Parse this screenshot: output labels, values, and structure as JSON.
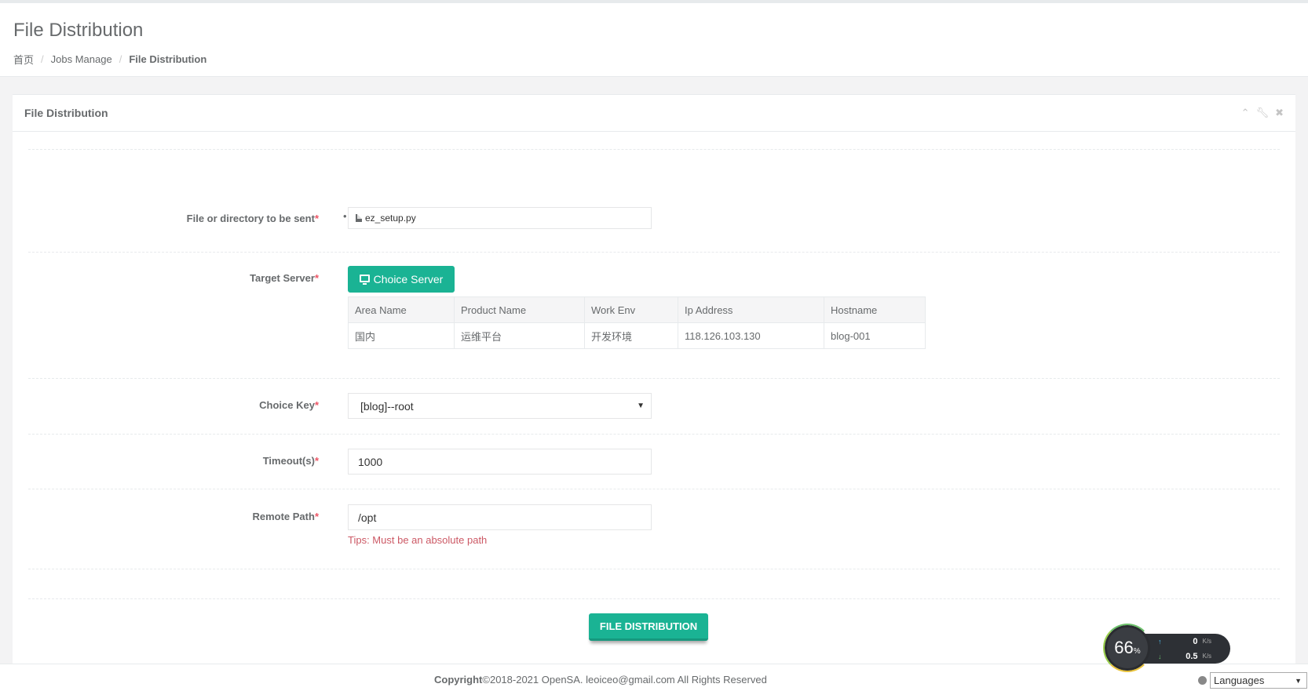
{
  "header": {
    "title": "File Distribution",
    "breadcrumb": [
      "首页",
      "Jobs Manage",
      "File Distribution"
    ]
  },
  "panel": {
    "title": "File Distribution",
    "tools": [
      "chevron-up",
      "wrench",
      "close"
    ]
  },
  "form": {
    "file_label": "File or directory to be sent",
    "file_value": "ez_setup.py",
    "target_label": "Target Server",
    "choice_server_button": "Choice Server",
    "table": {
      "headers": [
        "Area Name",
        "Product Name",
        "Work Env",
        "Ip Address",
        "Hostname"
      ],
      "rows": [
        [
          "国内",
          "运维平台",
          "开发环境",
          "118.126.103.130",
          "blog-001"
        ]
      ]
    },
    "key_label": "Choice Key",
    "key_value": "[blog]--root",
    "timeout_label": "Timeout(s)",
    "timeout_value": "1000",
    "remote_label": "Remote Path",
    "remote_value": "/opt",
    "remote_tip": "Tips: Must be an absolute path",
    "submit_button": "FILE DISTRIBUTION",
    "required_mark": "*"
  },
  "footer": {
    "copyright_bold": "Copyright",
    "copyright_text": "©2018-2021 OpenSA. leoiceo@gmail.com All Rights Reserved",
    "languages": "Languages"
  },
  "speed_widget": {
    "percent": "66",
    "percent_unit": "%",
    "upload": "0",
    "download": "0.5",
    "unit": "K/s"
  },
  "colors": {
    "primary": "#1ab394",
    "danger": "#ed5565",
    "tip": "#cc5965"
  }
}
